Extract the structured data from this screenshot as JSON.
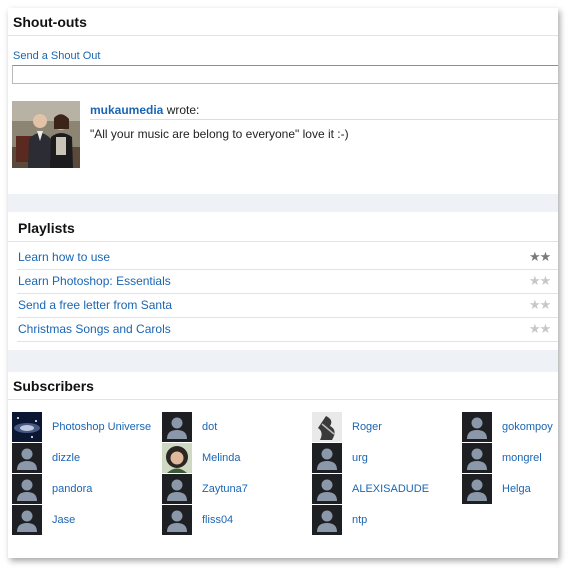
{
  "shoutouts": {
    "heading": "Shout-outs",
    "send_link": "Send a Shout Out",
    "input_value": "",
    "post": {
      "author": "mukaumedia",
      "verb": "wrote:",
      "text": "\"All your music are belong to everyone\" love it :-)"
    }
  },
  "playlists": {
    "heading": "Playlists",
    "items": [
      {
        "title": "Learn how to use",
        "rating": 2,
        "max_rating": 2
      },
      {
        "title": "Learn Photoshop: Essentials",
        "rating": 0,
        "max_rating": 2
      },
      {
        "title": "Send a free letter from Santa",
        "rating": 0,
        "max_rating": 2
      },
      {
        "title": "Christmas Songs and Carols",
        "rating": 0,
        "max_rating": 2
      }
    ]
  },
  "subscribers": {
    "heading": "Subscribers",
    "items": [
      {
        "name": "Photoshop Universe",
        "avatar": "photoshop-universe-avatar"
      },
      {
        "name": "dot",
        "avatar": "default-user-icon"
      },
      {
        "name": "Roger",
        "avatar": "roger-photo-avatar"
      },
      {
        "name": "gokompoy",
        "avatar": "default-user-icon"
      },
      {
        "name": "dizzle",
        "avatar": "default-user-icon"
      },
      {
        "name": "Melinda",
        "avatar": "melinda-photo-avatar"
      },
      {
        "name": "urg",
        "avatar": "default-user-icon"
      },
      {
        "name": "mongrel",
        "avatar": "default-user-icon"
      },
      {
        "name": "pandora",
        "avatar": "default-user-icon"
      },
      {
        "name": "Zaytuna7",
        "avatar": "default-user-icon"
      },
      {
        "name": "ALEXISADUDE",
        "avatar": "default-user-icon"
      },
      {
        "name": "Helga",
        "avatar": "default-user-icon"
      },
      {
        "name": "Jase",
        "avatar": "default-user-icon"
      },
      {
        "name": "fliss04",
        "avatar": "default-user-icon"
      },
      {
        "name": "ntp",
        "avatar": "default-user-icon"
      }
    ]
  },
  "colors": {
    "link": "#1a66b3",
    "separator": "#eef1f6",
    "star_on": "#7a7a7a",
    "star_off": "#c8c8c8"
  }
}
